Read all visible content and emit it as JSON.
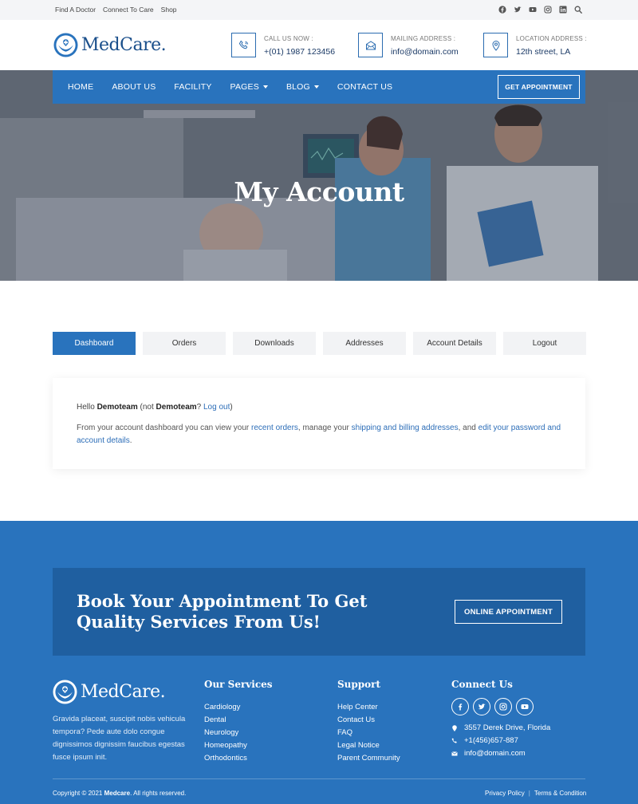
{
  "topbar": {
    "links": [
      "Find A Doctor",
      "Connect To Care",
      "Shop"
    ],
    "icons": [
      "facebook-icon",
      "twitter-icon",
      "youtube-icon",
      "instagram-icon",
      "linkedin-icon",
      "search-icon"
    ]
  },
  "header": {
    "logo": "MedCare.",
    "contacts": [
      {
        "icon": "phone-icon",
        "label": "CALL US NOW :",
        "value": "+(01) 1987 123456"
      },
      {
        "icon": "mail-icon",
        "label": "MAILING ADDRESS :",
        "value": "info@domain.com"
      },
      {
        "icon": "location-icon",
        "label": "LOCATION ADDRESS :",
        "value": "12th street, LA"
      }
    ]
  },
  "nav": {
    "items": [
      "HOME",
      "ABOUT US",
      "FACILITY",
      "PAGES",
      "BLOG",
      "CONTACT US"
    ],
    "cta": "GET APPOINTMENT"
  },
  "hero": {
    "title": "My Account"
  },
  "account": {
    "tabs": [
      "Dashboard",
      "Orders",
      "Downloads",
      "Addresses",
      "Account Details",
      "Logout"
    ],
    "active_tab": "Dashboard",
    "hello_prefix": "Hello ",
    "username": "Demoteam",
    "not_prefix": " (not ",
    "not_user": "Demoteam",
    "not_suffix": "? ",
    "logout_link": "Log out",
    "close_paren": ")",
    "desc_1": "From your account dashboard you can view your ",
    "link_orders": "recent orders",
    "desc_2": ", manage your ",
    "link_addresses": "shipping and billing addresses",
    "desc_3": ", and ",
    "link_password": "edit your password and account details",
    "desc_4": "."
  },
  "footer": {
    "cta_title": "Book Your Appointment To Get Quality Services From Us!",
    "cta_button": "ONLINE APPOINTMENT",
    "logo": "MedCare.",
    "about": "Gravida placeat, suscipit nobis vehicula tempora? Pede aute dolo congue dignissimos dignissim faucibus egestas fusce ipsum init.",
    "services_title": "Our Services",
    "services": [
      "Cardiology",
      "Dental",
      "Neurology",
      "Homeopathy",
      "Orthodontics"
    ],
    "support_title": "Support",
    "support": [
      "Help Center",
      "Contact Us",
      "FAQ",
      "Legal Notice",
      "Parent Community"
    ],
    "connect_title": "Connect Us",
    "socials": [
      "facebook-icon",
      "twitter-icon",
      "instagram-icon",
      "youtube-icon"
    ],
    "address": "3557 Derek Drive, Florida",
    "phone": "+1(456)657-887",
    "email": "info@domain.com",
    "copyright_prefix": "Copyright © 2021 ",
    "copyright_brand": "Medcare",
    "copyright_suffix": ". All rights reserved.",
    "policies": [
      "Privacy Policy",
      "Terms & Condition"
    ]
  },
  "colors": {
    "primary": "#2973bd",
    "dark": "#1f5fa0",
    "link": "#2d6eb8"
  }
}
